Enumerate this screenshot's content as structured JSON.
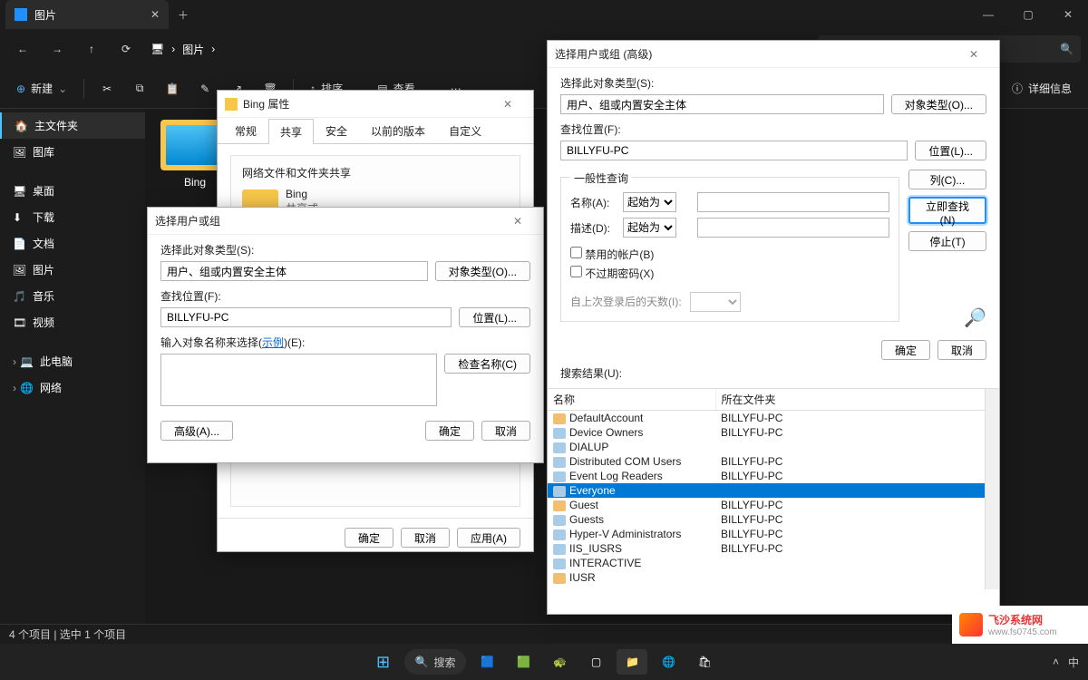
{
  "titlebar": {
    "tab_title": "图片",
    "close": "✕",
    "newtab": "＋",
    "min": "—",
    "max": "▢",
    "x": "✕"
  },
  "nav": {
    "back": "←",
    "fwd": "→",
    "up": "↑",
    "refresh": "⟳",
    "monitor": "🖥",
    "crumb1": "图片",
    "chev": "›",
    "search_icon": "🔍"
  },
  "cmd": {
    "new": "新建",
    "cut": "✂",
    "copy": "⧉",
    "paste": "▤",
    "rename": "✎",
    "share": "↗",
    "delete": "🗑",
    "sort": "排序",
    "view": "查看",
    "more": "⋯",
    "details": "详细信息"
  },
  "sidebar": {
    "items": [
      {
        "icon": "🏠",
        "label": "主文件夹",
        "sel": true
      },
      {
        "icon": "🖼",
        "label": "图库"
      },
      {
        "gap": true
      },
      {
        "icon": "🖥",
        "label": "桌面",
        "pin": true
      },
      {
        "icon": "⬇",
        "label": "下载",
        "pin": true
      },
      {
        "icon": "📄",
        "label": "文档",
        "pin": true
      },
      {
        "icon": "🖼",
        "label": "图片",
        "pin": true
      },
      {
        "icon": "🎵",
        "label": "音乐",
        "pin": true
      },
      {
        "icon": "🎞",
        "label": "视频",
        "pin": true
      },
      {
        "gap": true
      },
      {
        "icon": "💻",
        "label": "此电脑",
        "chev": true
      },
      {
        "icon": "🌐",
        "label": "网络",
        "chev": true
      }
    ]
  },
  "content": {
    "folder_name": "Bing"
  },
  "status": {
    "text": "4 个项目   |   选中 1 个项目"
  },
  "props": {
    "title": "Bing 属性",
    "tabs": [
      "常规",
      "共享",
      "安全",
      "以前的版本",
      "自定义"
    ],
    "active_tab": 1,
    "share_heading": "网络文件和文件夹共享",
    "item_name": "Bing",
    "item_state": "共享式",
    "ok": "确定",
    "cancel": "取消",
    "apply": "应用(A)"
  },
  "select_basic": {
    "title": "选择用户或组",
    "obj_type_lbl": "选择此对象类型(S):",
    "obj_type": "用户、组或内置安全主体",
    "obj_type_btn": "对象类型(O)...",
    "loc_lbl": "查找位置(F):",
    "loc": "BILLYFU-PC",
    "loc_btn": "位置(L)...",
    "enter_lbl": "输入对象名称来选择(",
    "example": "示例",
    "enter_lbl2": ")(E):",
    "check_btn": "检查名称(C)",
    "adv": "高级(A)...",
    "ok": "确定",
    "cancel": "取消"
  },
  "select_adv": {
    "title": "选择用户或组 (高级)",
    "obj_type_lbl": "选择此对象类型(S):",
    "obj_type": "用户、组或内置安全主体",
    "obj_type_btn": "对象类型(O)...",
    "loc_lbl": "查找位置(F):",
    "loc": "BILLYFU-PC",
    "loc_btn": "位置(L)...",
    "query": "一般性查询",
    "name_lbl": "名称(A):",
    "name_mode": "起始为",
    "desc_lbl": "描述(D):",
    "desc_mode": "起始为",
    "disabled_cb": "禁用的帐户(B)",
    "neverexp_cb": "不过期密码(X)",
    "days_lbl": "自上次登录后的天数(I):",
    "cols": "列(C)...",
    "find": "立即查找(N)",
    "stop": "停止(T)",
    "ok": "确定",
    "cancel": "取消",
    "results_lbl": "搜索结果(U):",
    "col_name": "名称",
    "col_folder": "所在文件夹",
    "rows": [
      {
        "t": "u",
        "n": "DefaultAccount",
        "f": "BILLYFU-PC"
      },
      {
        "t": "g",
        "n": "Device Owners",
        "f": "BILLYFU-PC"
      },
      {
        "t": "g",
        "n": "DIALUP",
        "f": ""
      },
      {
        "t": "g",
        "n": "Distributed COM Users",
        "f": "BILLYFU-PC"
      },
      {
        "t": "g",
        "n": "Event Log Readers",
        "f": "BILLYFU-PC"
      },
      {
        "t": "g",
        "n": "Everyone",
        "f": "",
        "sel": true
      },
      {
        "t": "u",
        "n": "Guest",
        "f": "BILLYFU-PC"
      },
      {
        "t": "g",
        "n": "Guests",
        "f": "BILLYFU-PC"
      },
      {
        "t": "g",
        "n": "Hyper-V Administrators",
        "f": "BILLYFU-PC"
      },
      {
        "t": "g",
        "n": "IIS_IUSRS",
        "f": "BILLYFU-PC"
      },
      {
        "t": "g",
        "n": "INTERACTIVE",
        "f": ""
      },
      {
        "t": "u",
        "n": "IUSR",
        "f": ""
      }
    ]
  },
  "taskbar": {
    "search": "搜索",
    "lang": "中"
  },
  "watermark": {
    "brand": "飞沙系统网",
    "url": "www.fs0745.com"
  }
}
